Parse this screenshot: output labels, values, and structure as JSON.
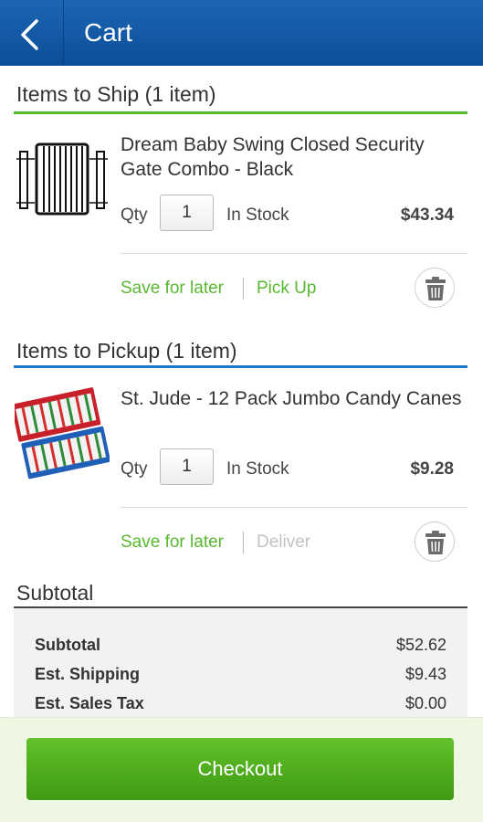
{
  "header": {
    "title": "Cart"
  },
  "ship_section": {
    "title": "Items to Ship (1 item)",
    "accent": "#59b831",
    "item": {
      "name": "Dream Baby Swing Closed Security Gate Combo - Black",
      "qty_label": "Qty",
      "qty": "1",
      "stock": "In Stock",
      "price": "$43.34",
      "save_label": "Save for later",
      "alt_action": "Pick Up"
    }
  },
  "pickup_section": {
    "title": "Items to Pickup (1 item)",
    "accent": "#1f77c9",
    "item": {
      "name": "St. Jude  - 12 Pack Jumbo Candy Canes",
      "qty_label": "Qty",
      "qty": "1",
      "stock": "In Stock",
      "price": "$9.28",
      "save_label": "Save for later",
      "alt_action": "Deliver"
    }
  },
  "summary": {
    "title": "Subtotal",
    "rows": [
      {
        "label": "Subtotal",
        "value": "$52.62"
      },
      {
        "label": "Est. Shipping",
        "value": "$9.43"
      },
      {
        "label": "Est. Sales Tax",
        "value": "$0.00"
      }
    ]
  },
  "checkout": {
    "label": "Checkout"
  },
  "colors": {
    "header": "#1c66b2",
    "green": "#59b831",
    "blue": "#1f77c9"
  }
}
